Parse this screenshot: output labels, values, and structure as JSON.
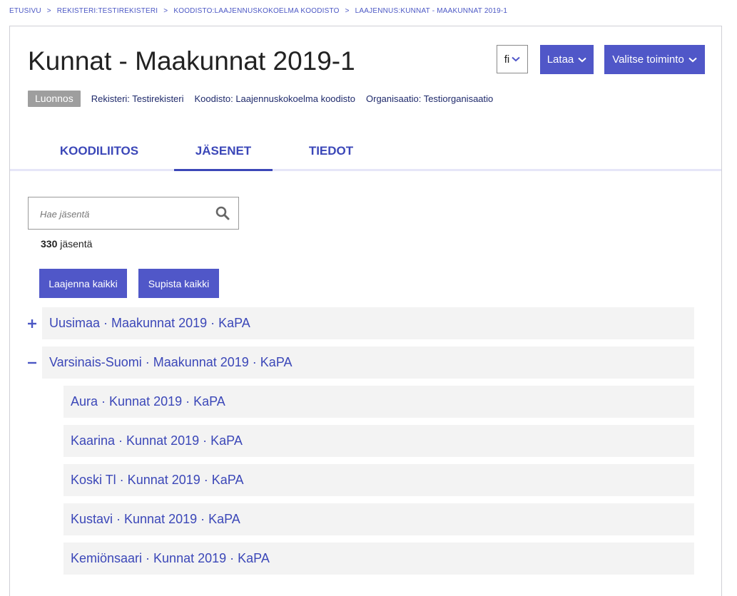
{
  "breadcrumb": [
    {
      "label": "ETUSIVU"
    },
    {
      "label": "REKISTERI:TESTIREKISTERI"
    },
    {
      "label": "KOODISTO:LAAJENNUSKOKOELMA KOODISTO"
    },
    {
      "label": "LAAJENNUS:KUNNAT - MAAKUNNAT 2019-1"
    }
  ],
  "breadcrumb_sep": ">",
  "page": {
    "title": "Kunnat - Maakunnat 2019-1",
    "lang": "fi",
    "download_label": "Lataa",
    "action_label": "Valitse toiminto"
  },
  "meta": {
    "status": "Luonnos",
    "registry": "Rekisteri: Testirekisteri",
    "codelist": "Koodisto: Laajennuskokoelma koodisto",
    "organization": "Organisaatio: Testiorganisaatio"
  },
  "tabs": [
    {
      "label": "KOODILIITOS",
      "active": false
    },
    {
      "label": "JÄSENET",
      "active": true
    },
    {
      "label": "TIEDOT",
      "active": false
    }
  ],
  "search": {
    "placeholder": "Hae jäsentä"
  },
  "members": {
    "count": "330",
    "count_suffix": "jäsentä"
  },
  "buttons": {
    "expand_all": "Laajenna kaikki",
    "collapse_all": "Supista kaikki"
  },
  "tree": [
    {
      "label": "Uusimaa · Maakunnat 2019 · KaPA",
      "level": 0,
      "expanded": false
    },
    {
      "label": "Varsinais-Suomi · Maakunnat 2019 · KaPA",
      "level": 0,
      "expanded": true
    },
    {
      "label": "Aura · Kunnat 2019 · KaPA",
      "level": 1
    },
    {
      "label": "Kaarina · Kunnat 2019 · KaPA",
      "level": 1
    },
    {
      "label": "Koski Tl · Kunnat 2019 · KaPA",
      "level": 1
    },
    {
      "label": "Kustavi · Kunnat 2019 · KaPA",
      "level": 1
    },
    {
      "label": "Kemiönsaari · Kunnat 2019 · KaPA",
      "level": 1
    }
  ],
  "colors": {
    "accent": "#5057c8",
    "link": "#3b47b8",
    "row_bg": "#f3f3f3",
    "badge": "#9e9e9e"
  }
}
